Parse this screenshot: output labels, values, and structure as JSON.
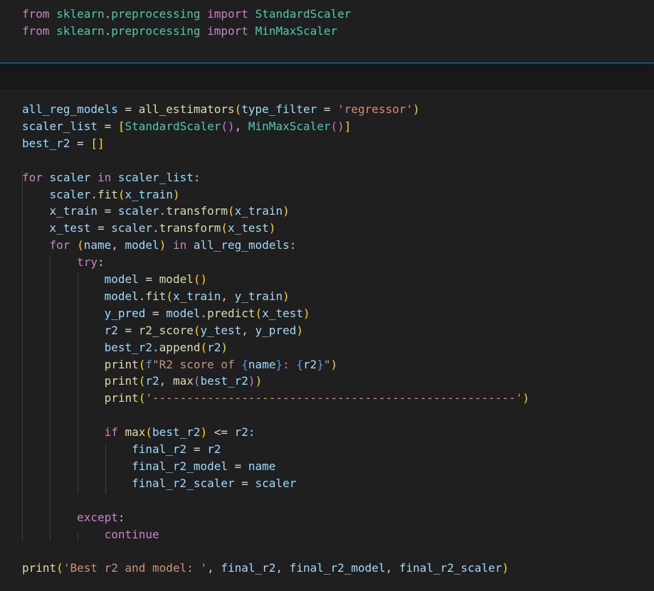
{
  "cells": {
    "imports": {
      "lines": [
        [
          {
            "t": "from",
            "c": "kw"
          },
          {
            "t": " "
          },
          {
            "t": "sklearn",
            "c": "mod"
          },
          {
            "t": "."
          },
          {
            "t": "preprocessing",
            "c": "mod"
          },
          {
            "t": " "
          },
          {
            "t": "import",
            "c": "kw"
          },
          {
            "t": " "
          },
          {
            "t": "StandardScaler",
            "c": "cls"
          }
        ],
        [
          {
            "t": "from",
            "c": "kw"
          },
          {
            "t": " "
          },
          {
            "t": "sklearn",
            "c": "mod"
          },
          {
            "t": "."
          },
          {
            "t": "preprocessing",
            "c": "mod"
          },
          {
            "t": " "
          },
          {
            "t": "import",
            "c": "kw"
          },
          {
            "t": " "
          },
          {
            "t": "MinMaxScaler",
            "c": "cls"
          }
        ]
      ]
    },
    "main": {
      "lines": [
        [
          {
            "t": "all_reg_models",
            "c": "var"
          },
          {
            "t": " = ",
            "c": "op"
          },
          {
            "t": "all_estimators",
            "c": "fn"
          },
          {
            "t": "(",
            "c": "p1"
          },
          {
            "t": "type_filter",
            "c": "var"
          },
          {
            "t": " = ",
            "c": "op"
          },
          {
            "t": "'regressor'",
            "c": "str"
          },
          {
            "t": ")",
            "c": "p1"
          }
        ],
        [
          {
            "t": "scaler_list",
            "c": "var"
          },
          {
            "t": " = ",
            "c": "op"
          },
          {
            "t": "[",
            "c": "p1"
          },
          {
            "t": "StandardScaler",
            "c": "cls"
          },
          {
            "t": "()",
            "c": "p2"
          },
          {
            "t": ", "
          },
          {
            "t": "MinMaxScaler",
            "c": "cls"
          },
          {
            "t": "()",
            "c": "p2"
          },
          {
            "t": "]",
            "c": "p1"
          }
        ],
        [
          {
            "t": "best_r2",
            "c": "var"
          },
          {
            "t": " = ",
            "c": "op"
          },
          {
            "t": "[]",
            "c": "p1"
          }
        ],
        [],
        [
          {
            "t": "for",
            "c": "kw"
          },
          {
            "t": " "
          },
          {
            "t": "scaler",
            "c": "var"
          },
          {
            "t": " "
          },
          {
            "t": "in",
            "c": "kw"
          },
          {
            "t": " "
          },
          {
            "t": "scaler_list",
            "c": "var"
          },
          {
            "t": ":"
          }
        ],
        [
          {
            "t": "    "
          },
          {
            "t": "scaler",
            "c": "var"
          },
          {
            "t": "."
          },
          {
            "t": "fit",
            "c": "fn"
          },
          {
            "t": "(",
            "c": "p1"
          },
          {
            "t": "x_train",
            "c": "var"
          },
          {
            "t": ")",
            "c": "p1"
          }
        ],
        [
          {
            "t": "    "
          },
          {
            "t": "x_train",
            "c": "var"
          },
          {
            "t": " = ",
            "c": "op"
          },
          {
            "t": "scaler",
            "c": "var"
          },
          {
            "t": "."
          },
          {
            "t": "transform",
            "c": "fn"
          },
          {
            "t": "(",
            "c": "p1"
          },
          {
            "t": "x_train",
            "c": "var"
          },
          {
            "t": ")",
            "c": "p1"
          }
        ],
        [
          {
            "t": "    "
          },
          {
            "t": "x_test",
            "c": "var"
          },
          {
            "t": " = ",
            "c": "op"
          },
          {
            "t": "scaler",
            "c": "var"
          },
          {
            "t": "."
          },
          {
            "t": "transform",
            "c": "fn"
          },
          {
            "t": "(",
            "c": "p1"
          },
          {
            "t": "x_test",
            "c": "var"
          },
          {
            "t": ")",
            "c": "p1"
          }
        ],
        [
          {
            "t": "    "
          },
          {
            "t": "for",
            "c": "kw"
          },
          {
            "t": " "
          },
          {
            "t": "(",
            "c": "p1"
          },
          {
            "t": "name",
            "c": "var"
          },
          {
            "t": ", "
          },
          {
            "t": "model",
            "c": "var"
          },
          {
            "t": ")",
            "c": "p1"
          },
          {
            "t": " "
          },
          {
            "t": "in",
            "c": "kw"
          },
          {
            "t": " "
          },
          {
            "t": "all_reg_models",
            "c": "var"
          },
          {
            "t": ":"
          }
        ],
        [
          {
            "t": "        "
          },
          {
            "t": "try",
            "c": "kw"
          },
          {
            "t": ":"
          }
        ],
        [
          {
            "t": "            "
          },
          {
            "t": "model",
            "c": "var"
          },
          {
            "t": " = ",
            "c": "op"
          },
          {
            "t": "model",
            "c": "fn"
          },
          {
            "t": "()",
            "c": "p1"
          }
        ],
        [
          {
            "t": "            "
          },
          {
            "t": "model",
            "c": "var"
          },
          {
            "t": "."
          },
          {
            "t": "fit",
            "c": "fn"
          },
          {
            "t": "(",
            "c": "p1"
          },
          {
            "t": "x_train",
            "c": "var"
          },
          {
            "t": ", "
          },
          {
            "t": "y_train",
            "c": "var"
          },
          {
            "t": ")",
            "c": "p1"
          }
        ],
        [
          {
            "t": "            "
          },
          {
            "t": "y_pred",
            "c": "var"
          },
          {
            "t": " = ",
            "c": "op"
          },
          {
            "t": "model",
            "c": "var"
          },
          {
            "t": "."
          },
          {
            "t": "predict",
            "c": "fn"
          },
          {
            "t": "(",
            "c": "p1"
          },
          {
            "t": "x_test",
            "c": "var"
          },
          {
            "t": ")",
            "c": "p1"
          }
        ],
        [
          {
            "t": "            "
          },
          {
            "t": "r2",
            "c": "var"
          },
          {
            "t": " = ",
            "c": "op"
          },
          {
            "t": "r2_score",
            "c": "fn"
          },
          {
            "t": "(",
            "c": "p1"
          },
          {
            "t": "y_test",
            "c": "var"
          },
          {
            "t": ", "
          },
          {
            "t": "y_pred",
            "c": "var"
          },
          {
            "t": ")",
            "c": "p1"
          }
        ],
        [
          {
            "t": "            "
          },
          {
            "t": "best_r2",
            "c": "var"
          },
          {
            "t": "."
          },
          {
            "t": "append",
            "c": "fn"
          },
          {
            "t": "(",
            "c": "p1"
          },
          {
            "t": "r2",
            "c": "var"
          },
          {
            "t": ")",
            "c": "p1"
          }
        ],
        [
          {
            "t": "            "
          },
          {
            "t": "print",
            "c": "fn"
          },
          {
            "t": "(",
            "c": "p1"
          },
          {
            "t": "f",
            "c": "fpre"
          },
          {
            "t": "\"R2 score of ",
            "c": "str"
          },
          {
            "t": "{",
            "c": "fpre"
          },
          {
            "t": "name",
            "c": "var"
          },
          {
            "t": "}",
            "c": "fpre"
          },
          {
            "t": ": ",
            "c": "str"
          },
          {
            "t": "{",
            "c": "fpre"
          },
          {
            "t": "r2",
            "c": "var"
          },
          {
            "t": "}",
            "c": "fpre"
          },
          {
            "t": "\"",
            "c": "str"
          },
          {
            "t": ")",
            "c": "p1"
          }
        ],
        [
          {
            "t": "            "
          },
          {
            "t": "print",
            "c": "fn"
          },
          {
            "t": "(",
            "c": "p1"
          },
          {
            "t": "r2",
            "c": "var"
          },
          {
            "t": ", "
          },
          {
            "t": "max",
            "c": "fn"
          },
          {
            "t": "(",
            "c": "p2"
          },
          {
            "t": "best_r2",
            "c": "var"
          },
          {
            "t": ")",
            "c": "p2"
          },
          {
            "t": ")",
            "c": "p1"
          }
        ],
        [
          {
            "t": "            "
          },
          {
            "t": "print",
            "c": "fn"
          },
          {
            "t": "(",
            "c": "p1"
          },
          {
            "t": "'-----------------------------------------------------'",
            "c": "str"
          },
          {
            "t": ")",
            "c": "p1"
          }
        ],
        [],
        [
          {
            "t": "            "
          },
          {
            "t": "if",
            "c": "kw"
          },
          {
            "t": " "
          },
          {
            "t": "max",
            "c": "fn"
          },
          {
            "t": "(",
            "c": "p1"
          },
          {
            "t": "best_r2",
            "c": "var"
          },
          {
            "t": ")",
            "c": "p1"
          },
          {
            "t": " <= ",
            "c": "op"
          },
          {
            "t": "r2",
            "c": "var"
          },
          {
            "t": ":"
          }
        ],
        [
          {
            "t": "                "
          },
          {
            "t": "final_r2",
            "c": "var"
          },
          {
            "t": " = ",
            "c": "op"
          },
          {
            "t": "r2",
            "c": "var"
          }
        ],
        [
          {
            "t": "                "
          },
          {
            "t": "final_r2_model",
            "c": "var"
          },
          {
            "t": " = ",
            "c": "op"
          },
          {
            "t": "name",
            "c": "var"
          }
        ],
        [
          {
            "t": "                "
          },
          {
            "t": "final_r2_scaler",
            "c": "var"
          },
          {
            "t": " = ",
            "c": "op"
          },
          {
            "t": "scaler",
            "c": "var"
          }
        ],
        [],
        [
          {
            "t": "        "
          },
          {
            "t": "except",
            "c": "kw"
          },
          {
            "t": ":"
          }
        ],
        [
          {
            "t": "            "
          },
          {
            "t": "continue",
            "c": "kw"
          }
        ],
        [],
        [
          {
            "t": "print",
            "c": "fn"
          },
          {
            "t": "(",
            "c": "p1"
          },
          {
            "t": "'Best r2 and model: '",
            "c": "str"
          },
          {
            "t": ", "
          },
          {
            "t": "final_r2",
            "c": "var"
          },
          {
            "t": ", "
          },
          {
            "t": "final_r2_model",
            "c": "var"
          },
          {
            "t": ", "
          },
          {
            "t": "final_r2_scaler",
            "c": "var"
          },
          {
            "t": ")",
            "c": "p1"
          }
        ]
      ]
    }
  }
}
